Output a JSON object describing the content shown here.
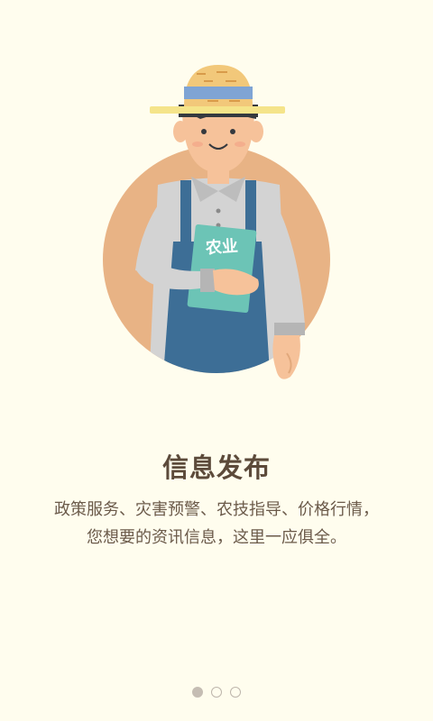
{
  "intro": {
    "illustration": {
      "book_label": "农业",
      "colors": {
        "background": "#FFFDEE",
        "circle": "#E8B385",
        "overalls": "#3D6E96",
        "shirt": "#D2D2D2",
        "book": "#6CC4B6",
        "hat": "#F2C87A",
        "hat_band": "#7FA4D4"
      }
    },
    "title": "信息发布",
    "description_line1": "政策服务、灾害预警、农技指导、价格行情，",
    "description_line2": "您想要的资讯信息，这里一应俱全。"
  },
  "pager": {
    "current_page": 1,
    "total_pages": 3
  }
}
